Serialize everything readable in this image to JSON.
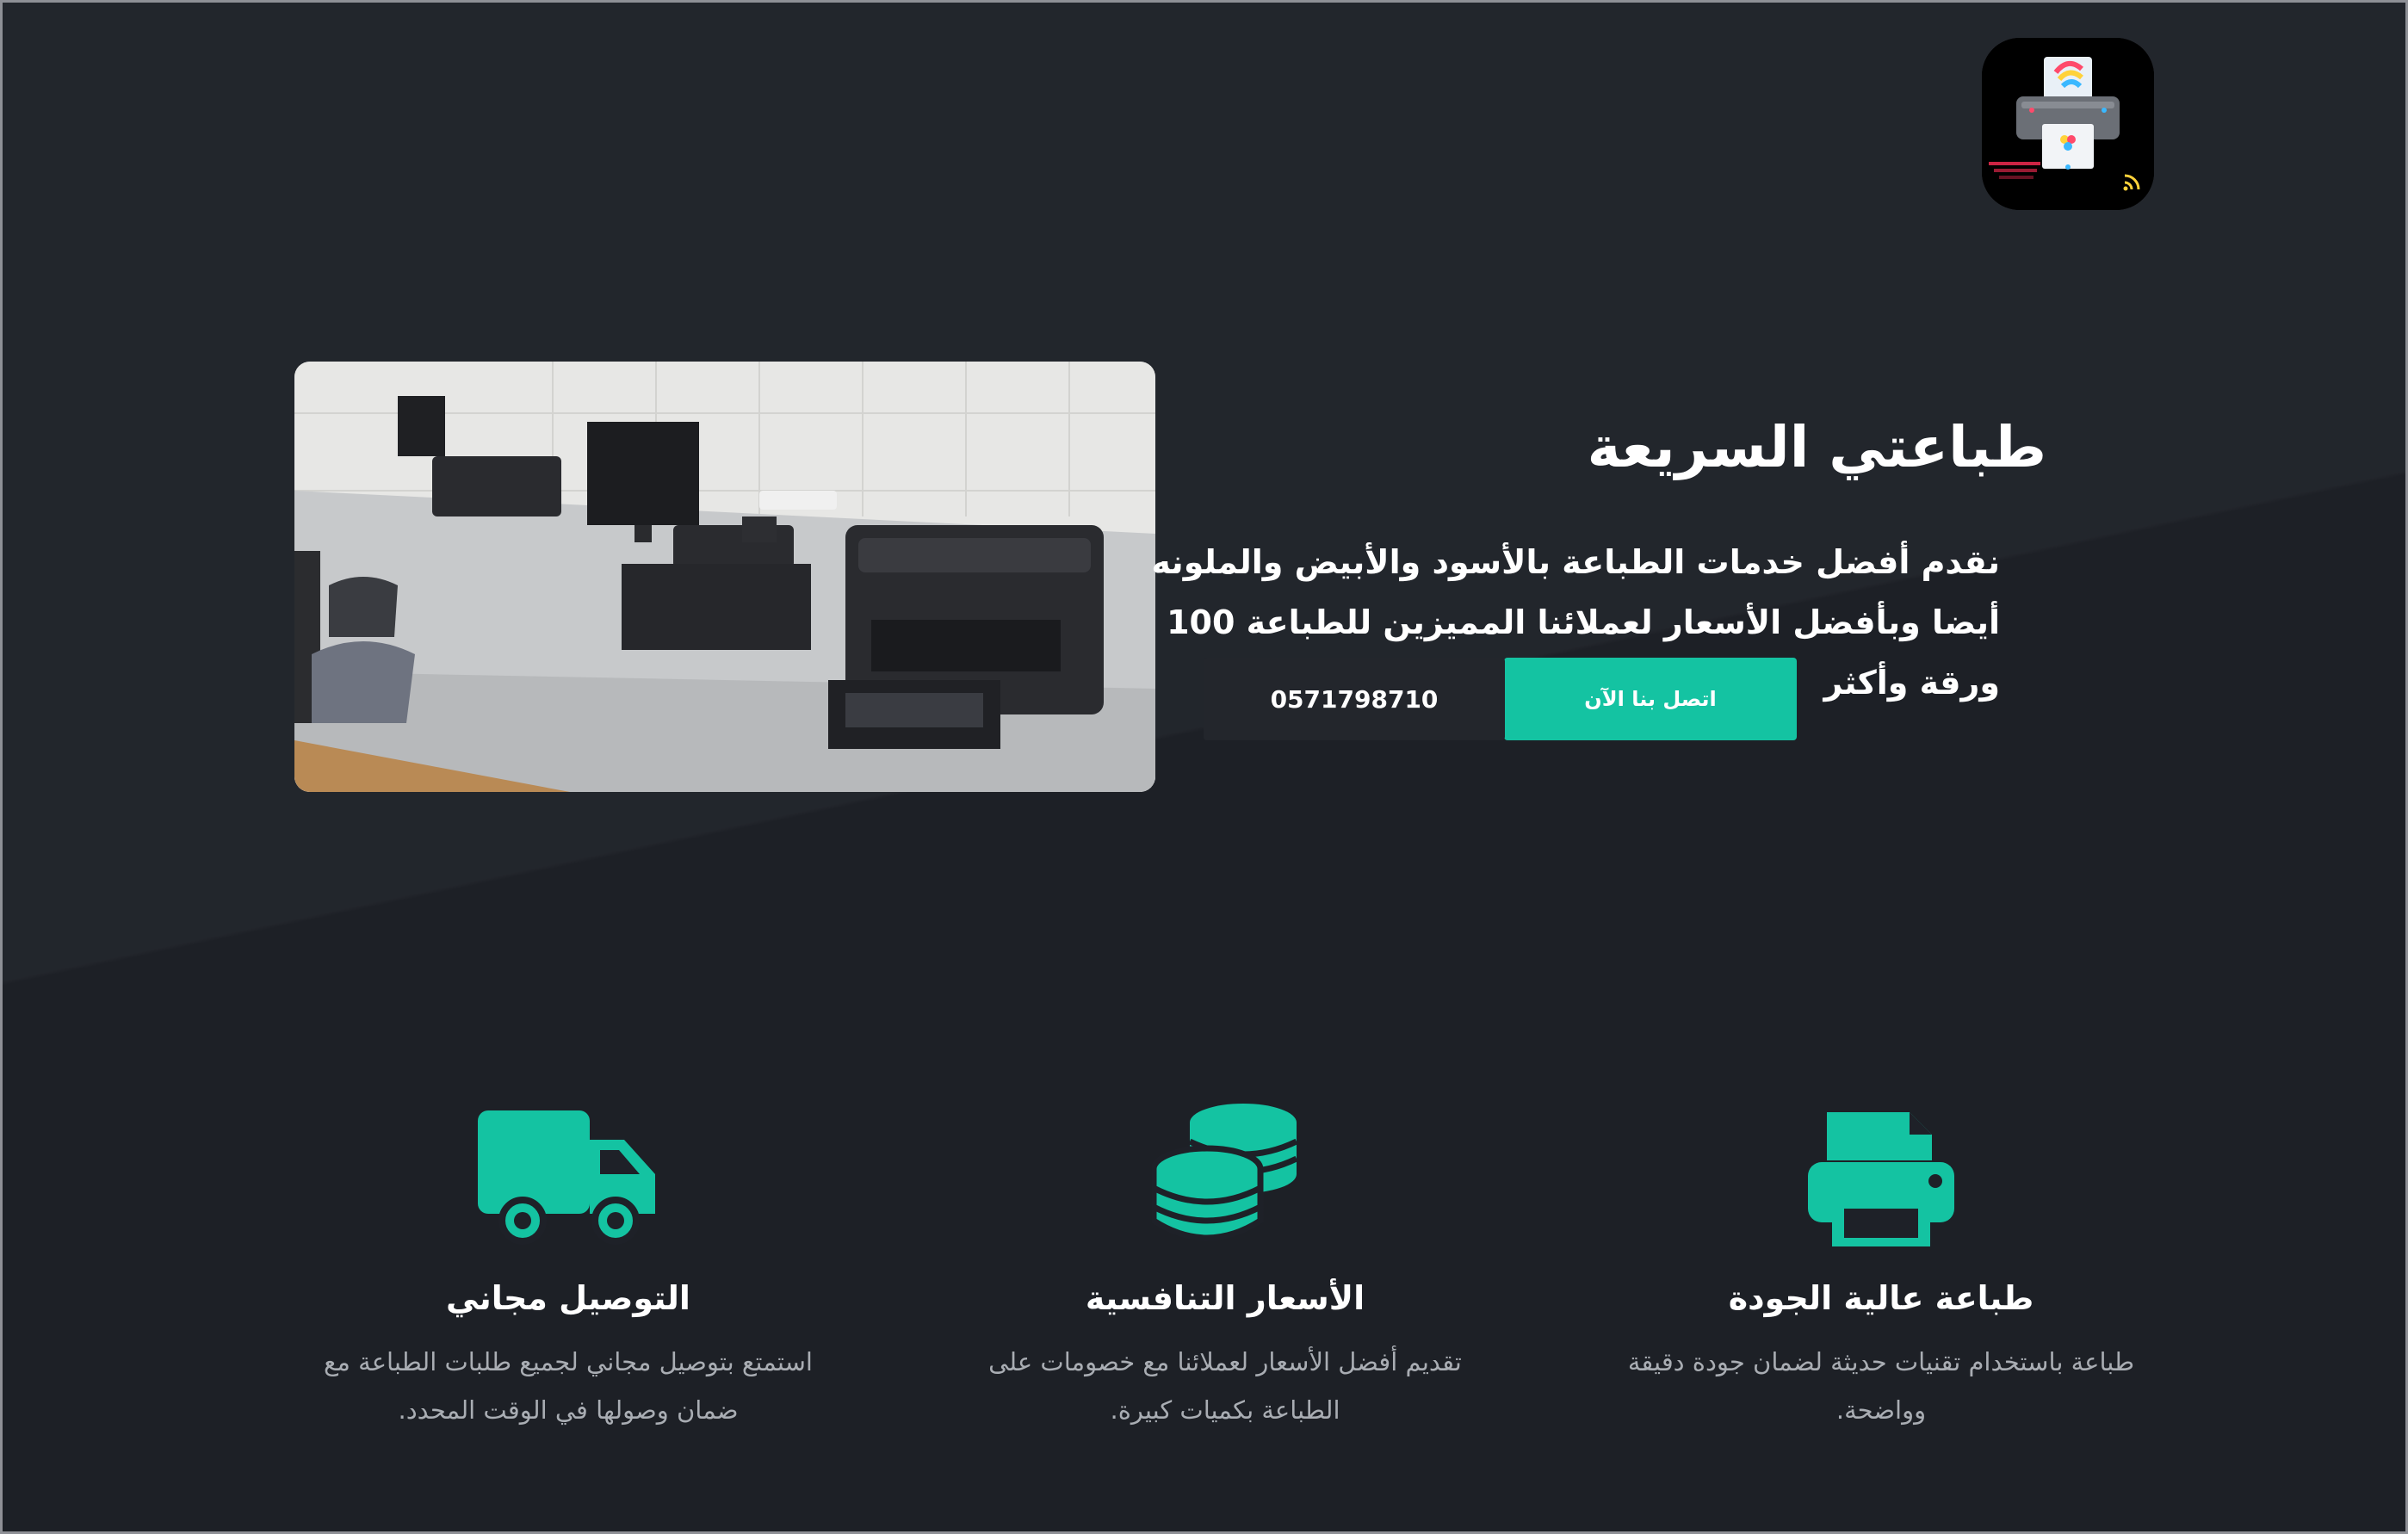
{
  "brand": {
    "logo_alt": "Printer logo"
  },
  "hero": {
    "title": "طباعتي السريعة",
    "description": "نقدم أفضل خدمات الطباعة بالأسود والأبيض والملونه أيضا وبأفضل الأسعار لعملائنا المميزين للطباعة 100 ورقة وأكثر",
    "contact_button": "اتصل بنا الآن",
    "phone": "0571798710"
  },
  "features": [
    {
      "icon": "printer-icon",
      "title": "طباعة عالية الجودة",
      "description": "طباعة باستخدام تقنيات حديثة لضمان جودة دقيقة وواضحة."
    },
    {
      "icon": "coins-icon",
      "title": "الأسعار التنافسية",
      "description": "تقديم أفضل الأسعار لعملائنا مع خصومات على الطباعة بكميات كبيرة."
    },
    {
      "icon": "truck-icon",
      "title": "التوصيل مجاني",
      "description": "استمتع بتوصيل مجاني لجميع طلبات الطباعة مع ضمان وصولها في الوقت المحدد."
    }
  ],
  "colors": {
    "background": "#1e2128",
    "accent": "#14c3a2",
    "phone_button": "#23262c",
    "muted_text": "#a9adb3"
  }
}
